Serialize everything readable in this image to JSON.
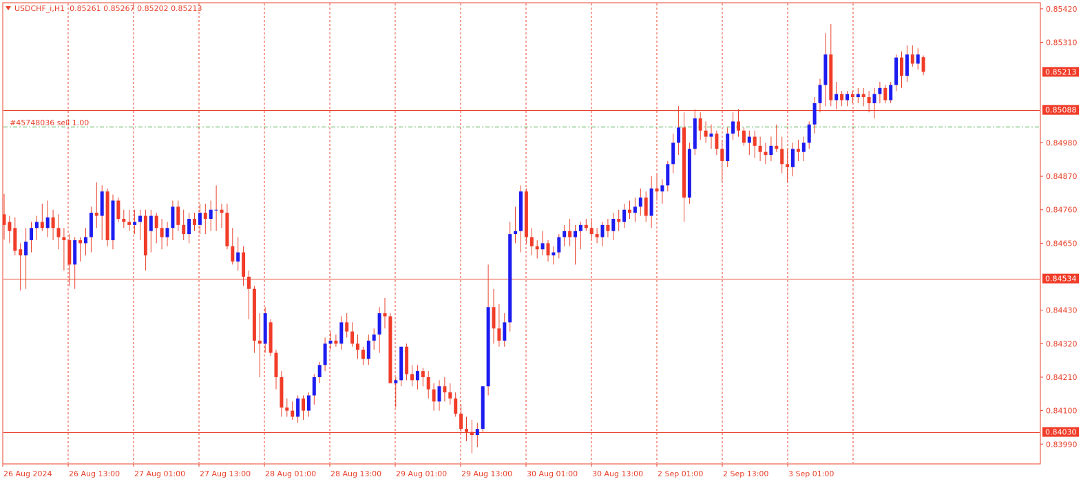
{
  "header": {
    "symbol": "USDCHF_i,H1",
    "ohlc": "0.85261 0.85267 0.85202 0.85213"
  },
  "order_line": {
    "label": "#45748036 sell 1.00",
    "price": 0.85032,
    "color": "#2ca02c"
  },
  "colors": {
    "bull": "#1c1cf0",
    "bear": "#f03c28",
    "wick": "#e8412b",
    "axis": "#e8412b",
    "grid": "#e8412b",
    "background": "#ffffff"
  },
  "chart_data": {
    "type": "candlestick",
    "ylim": [
      0.83925,
      0.8544
    ],
    "y_ticks": [
      0.8542,
      0.8531,
      0.8498,
      0.8487,
      0.8476,
      0.8465,
      0.8443,
      0.8432,
      0.8421,
      0.841,
      0.8399
    ],
    "y_tick_labels": [
      "0.85420",
      "0.85310",
      "0.84980",
      "0.84870",
      "0.84760",
      "0.84650",
      "0.84430",
      "0.84320",
      "0.84210",
      "0.84100",
      "0.83990"
    ],
    "x_tick_labels": [
      "26 Aug 2024",
      "26 Aug 13:00",
      "27 Aug 01:00",
      "27 Aug 13:00",
      "28 Aug 01:00",
      "28 Aug 13:00",
      "29 Aug 01:00",
      "29 Aug 13:00",
      "30 Aug 01:00",
      "30 Aug 13:00",
      "2 Sep 01:00",
      "2 Sep 13:00",
      "3 Sep 01:00"
    ],
    "horizontal_levels": [
      {
        "price": 0.85088,
        "label": "0.85088"
      },
      {
        "price": 0.84534,
        "label": "0.84534"
      },
      {
        "price": 0.8403,
        "label": "0.84030"
      }
    ],
    "current_price": {
      "price": 0.85213,
      "label": "0.85213"
    },
    "candles": [
      [
        0.84745,
        0.84812,
        0.84662,
        0.8471
      ],
      [
        0.8472,
        0.8474,
        0.8465,
        0.8469
      ],
      [
        0.847,
        0.84735,
        0.8461,
        0.84625
      ],
      [
        0.8463,
        0.8465,
        0.84495,
        0.8461
      ],
      [
        0.8461,
        0.847,
        0.845,
        0.84655
      ],
      [
        0.8466,
        0.8472,
        0.8462,
        0.847
      ],
      [
        0.847,
        0.8474,
        0.8466,
        0.8472
      ],
      [
        0.8472,
        0.8478,
        0.8469,
        0.847
      ],
      [
        0.847,
        0.8479,
        0.8467,
        0.84735
      ],
      [
        0.84735,
        0.8476,
        0.8466,
        0.847
      ],
      [
        0.847,
        0.84745,
        0.8463,
        0.8467
      ],
      [
        0.8467,
        0.847,
        0.8456,
        0.8466
      ],
      [
        0.8466,
        0.8468,
        0.8451,
        0.8458
      ],
      [
        0.8458,
        0.8467,
        0.845,
        0.8466
      ],
      [
        0.8466,
        0.8467,
        0.8459,
        0.8465
      ],
      [
        0.8465,
        0.847,
        0.8461,
        0.8467
      ],
      [
        0.8467,
        0.8477,
        0.8462,
        0.8475
      ],
      [
        0.8475,
        0.8485,
        0.847,
        0.8474
      ],
      [
        0.8474,
        0.8484,
        0.8466,
        0.8482
      ],
      [
        0.8482,
        0.8483,
        0.8464,
        0.8466
      ],
      [
        0.8466,
        0.8481,
        0.8463,
        0.8479
      ],
      [
        0.8479,
        0.848,
        0.8472,
        0.8473
      ],
      [
        0.8473,
        0.8476,
        0.847,
        0.8472
      ],
      [
        0.8472,
        0.8476,
        0.8469,
        0.8471
      ],
      [
        0.8471,
        0.8476,
        0.8468,
        0.8472
      ],
      [
        0.8472,
        0.8476,
        0.8466,
        0.8474
      ],
      [
        0.8474,
        0.8476,
        0.8456,
        0.8461
      ],
      [
        0.8469,
        0.8476,
        0.8462,
        0.8474
      ],
      [
        0.8474,
        0.8475,
        0.8465,
        0.847
      ],
      [
        0.847,
        0.8473,
        0.8463,
        0.8467
      ],
      [
        0.8467,
        0.8472,
        0.8464,
        0.847
      ],
      [
        0.847,
        0.8479,
        0.8466,
        0.8477
      ],
      [
        0.8477,
        0.8479,
        0.8469,
        0.8471
      ],
      [
        0.8471,
        0.8476,
        0.8466,
        0.8468
      ],
      [
        0.8468,
        0.8475,
        0.8465,
        0.8473
      ],
      [
        0.8473,
        0.8475,
        0.8469,
        0.8471
      ],
      [
        0.8471,
        0.8478,
        0.8468,
        0.8475
      ],
      [
        0.8475,
        0.8478,
        0.8468,
        0.8473
      ],
      [
        0.8473,
        0.8479,
        0.8469,
        0.8476
      ],
      [
        0.8476,
        0.8484,
        0.8469,
        0.8476
      ],
      [
        0.8476,
        0.8478,
        0.847,
        0.8475
      ],
      [
        0.8475,
        0.8478,
        0.8463,
        0.8464
      ],
      [
        0.8464,
        0.847,
        0.8458,
        0.8459
      ],
      [
        0.8459,
        0.8467,
        0.8456,
        0.8462
      ],
      [
        0.8462,
        0.8464,
        0.8451,
        0.8454
      ],
      [
        0.8454,
        0.8456,
        0.844,
        0.845
      ],
      [
        0.845,
        0.8451,
        0.8429,
        0.8433
      ],
      [
        0.8433,
        0.8442,
        0.8421,
        0.8432
      ],
      [
        0.8432,
        0.8444,
        0.8429,
        0.8442
      ],
      [
        0.8439,
        0.844,
        0.8428,
        0.8429
      ],
      [
        0.8429,
        0.843,
        0.8417,
        0.8421
      ],
      [
        0.8421,
        0.8423,
        0.8408,
        0.8411
      ],
      [
        0.8411,
        0.8414,
        0.8408,
        0.841
      ],
      [
        0.841,
        0.8413,
        0.8407,
        0.8408
      ],
      [
        0.8408,
        0.8415,
        0.8406,
        0.8414
      ],
      [
        0.8414,
        0.8415,
        0.8407,
        0.841
      ],
      [
        0.841,
        0.8416,
        0.8408,
        0.8415
      ],
      [
        0.8415,
        0.8422,
        0.8412,
        0.8421
      ],
      [
        0.8421,
        0.8426,
        0.8419,
        0.8425
      ],
      [
        0.8425,
        0.8434,
        0.8423,
        0.8432
      ],
      [
        0.8432,
        0.8436,
        0.843,
        0.8433
      ],
      [
        0.8433,
        0.8435,
        0.8431,
        0.8432
      ],
      [
        0.8432,
        0.8441,
        0.843,
        0.8439
      ],
      [
        0.8439,
        0.8442,
        0.8434,
        0.8436
      ],
      [
        0.8436,
        0.8439,
        0.8431,
        0.8432
      ],
      [
        0.8432,
        0.8435,
        0.8427,
        0.843
      ],
      [
        0.843,
        0.8431,
        0.8425,
        0.8427
      ],
      [
        0.8427,
        0.8435,
        0.8425,
        0.8433
      ],
      [
        0.8433,
        0.8437,
        0.843,
        0.8435
      ],
      [
        0.8435,
        0.8444,
        0.8429,
        0.8442
      ],
      [
        0.8442,
        0.8447,
        0.8437,
        0.8441
      ],
      [
        0.8441,
        0.8442,
        0.8422,
        0.8419
      ],
      [
        0.8419,
        0.8421,
        0.8411,
        0.842
      ],
      [
        0.842,
        0.843,
        0.8418,
        0.8431
      ],
      [
        0.8431,
        0.8432,
        0.842,
        0.8422
      ],
      [
        0.8422,
        0.8425,
        0.8418,
        0.842
      ],
      [
        0.842,
        0.8425,
        0.8417,
        0.8423
      ],
      [
        0.8423,
        0.8424,
        0.8418,
        0.8421
      ],
      [
        0.8421,
        0.8423,
        0.8414,
        0.8417
      ],
      [
        0.8417,
        0.8419,
        0.841,
        0.8413
      ],
      [
        0.8413,
        0.842,
        0.841,
        0.8418
      ],
      [
        0.8418,
        0.8421,
        0.8413,
        0.8416
      ],
      [
        0.8416,
        0.8419,
        0.8412,
        0.8414
      ],
      [
        0.8414,
        0.8416,
        0.8408,
        0.8409
      ],
      [
        0.8409,
        0.8412,
        0.8403,
        0.8404
      ],
      [
        0.8404,
        0.8408,
        0.84,
        0.8403
      ],
      [
        0.8403,
        0.8407,
        0.8396,
        0.8402
      ],
      [
        0.8402,
        0.8406,
        0.8398,
        0.8404
      ],
      [
        0.8404,
        0.8418,
        0.8403,
        0.8418
      ],
      [
        0.8418,
        0.8458,
        0.8415,
        0.8444
      ],
      [
        0.8444,
        0.845,
        0.8432,
        0.8437
      ],
      [
        0.8437,
        0.8445,
        0.8431,
        0.8433
      ],
      [
        0.8433,
        0.8442,
        0.8431,
        0.8439
      ],
      [
        0.8439,
        0.8472,
        0.8436,
        0.8468
      ],
      [
        0.8468,
        0.8477,
        0.8465,
        0.8469
      ],
      [
        0.8469,
        0.8484,
        0.8462,
        0.8482
      ],
      [
        0.8482,
        0.8483,
        0.8465,
        0.8467
      ],
      [
        0.8467,
        0.847,
        0.8461,
        0.8464
      ],
      [
        0.8464,
        0.8466,
        0.846,
        0.8463
      ],
      [
        0.8463,
        0.8469,
        0.8461,
        0.8465
      ],
      [
        0.8465,
        0.8466,
        0.8459,
        0.8461
      ],
      [
        0.8461,
        0.8464,
        0.8458,
        0.8462
      ],
      [
        0.8462,
        0.8468,
        0.846,
        0.8467
      ],
      [
        0.8467,
        0.8471,
        0.8464,
        0.8469
      ],
      [
        0.8469,
        0.8473,
        0.8464,
        0.8467
      ],
      [
        0.8467,
        0.8471,
        0.8458,
        0.8469
      ],
      [
        0.8469,
        0.8472,
        0.8463,
        0.8471
      ],
      [
        0.8471,
        0.8473,
        0.8469,
        0.847
      ],
      [
        0.847,
        0.8473,
        0.8466,
        0.8468
      ],
      [
        0.8468,
        0.847,
        0.8465,
        0.8467
      ],
      [
        0.8467,
        0.8472,
        0.8464,
        0.8471
      ],
      [
        0.8471,
        0.8473,
        0.8467,
        0.8469
      ],
      [
        0.8469,
        0.8475,
        0.8466,
        0.8473
      ],
      [
        0.8473,
        0.8476,
        0.8469,
        0.8472
      ],
      [
        0.8472,
        0.8478,
        0.847,
        0.8476
      ],
      [
        0.8476,
        0.8479,
        0.8473,
        0.8475
      ],
      [
        0.8475,
        0.848,
        0.8472,
        0.8477
      ],
      [
        0.8477,
        0.8483,
        0.8474,
        0.848
      ],
      [
        0.848,
        0.8482,
        0.8472,
        0.8474
      ],
      [
        0.8474,
        0.8487,
        0.847,
        0.8483
      ],
      [
        0.8483,
        0.8488,
        0.8479,
        0.8482
      ],
      [
        0.8482,
        0.8486,
        0.8478,
        0.8484
      ],
      [
        0.8484,
        0.8492,
        0.8482,
        0.8491
      ],
      [
        0.8491,
        0.8501,
        0.8488,
        0.8498
      ],
      [
        0.8498,
        0.851,
        0.8494,
        0.8503
      ],
      [
        0.8503,
        0.8508,
        0.8472,
        0.848
      ],
      [
        0.848,
        0.8498,
        0.8478,
        0.8496
      ],
      [
        0.8496,
        0.8509,
        0.8494,
        0.8506
      ],
      [
        0.8506,
        0.8508,
        0.8499,
        0.8502
      ],
      [
        0.8502,
        0.8505,
        0.8498,
        0.85
      ],
      [
        0.85,
        0.8504,
        0.8496,
        0.8501
      ],
      [
        0.8501,
        0.8502,
        0.8494,
        0.8496
      ],
      [
        0.8496,
        0.8499,
        0.8485,
        0.8492
      ],
      [
        0.8492,
        0.8503,
        0.849,
        0.8501
      ],
      [
        0.8501,
        0.8508,
        0.8499,
        0.8505
      ],
      [
        0.8505,
        0.8509,
        0.85,
        0.8502
      ],
      [
        0.8502,
        0.8503,
        0.8497,
        0.8498
      ],
      [
        0.8498,
        0.8502,
        0.8494,
        0.85
      ],
      [
        0.85,
        0.8502,
        0.8493,
        0.8497
      ],
      [
        0.8497,
        0.85,
        0.8492,
        0.8495
      ],
      [
        0.8495,
        0.8498,
        0.8491,
        0.8494
      ],
      [
        0.8494,
        0.85,
        0.8492,
        0.8497
      ],
      [
        0.8497,
        0.8504,
        0.8495,
        0.8496
      ],
      [
        0.8496,
        0.85,
        0.8488,
        0.8491
      ],
      [
        0.8491,
        0.8496,
        0.8485,
        0.849
      ],
      [
        0.849,
        0.8498,
        0.8487,
        0.8496
      ],
      [
        0.8496,
        0.8499,
        0.8492,
        0.8495
      ],
      [
        0.8495,
        0.85,
        0.8492,
        0.8498
      ],
      [
        0.8498,
        0.8505,
        0.8496,
        0.8504
      ],
      [
        0.8504,
        0.8513,
        0.8501,
        0.8511
      ],
      [
        0.8511,
        0.8519,
        0.8508,
        0.8517
      ],
      [
        0.8517,
        0.8534,
        0.851,
        0.8527
      ],
      [
        0.8527,
        0.8537,
        0.851,
        0.8512
      ],
      [
        0.8512,
        0.8518,
        0.8509,
        0.8514
      ],
      [
        0.8514,
        0.8515,
        0.851,
        0.8512
      ],
      [
        0.8512,
        0.8515,
        0.851,
        0.8514
      ],
      [
        0.8514,
        0.8515,
        0.8511,
        0.8513
      ],
      [
        0.8513,
        0.8516,
        0.8511,
        0.8514
      ],
      [
        0.8514,
        0.8516,
        0.851,
        0.8513
      ],
      [
        0.8513,
        0.8515,
        0.8508,
        0.8511
      ],
      [
        0.8511,
        0.8516,
        0.8506,
        0.8514
      ],
      [
        0.8514,
        0.8518,
        0.8511,
        0.8516
      ],
      [
        0.8516,
        0.8517,
        0.8511,
        0.8512
      ],
      [
        0.8512,
        0.8518,
        0.8511,
        0.8517
      ],
      [
        0.8517,
        0.8527,
        0.8515,
        0.8526
      ],
      [
        0.8526,
        0.8528,
        0.8516,
        0.852
      ],
      [
        0.852,
        0.853,
        0.8518,
        0.8527
      ],
      [
        0.8527,
        0.853,
        0.8523,
        0.8524
      ],
      [
        0.8524,
        0.8529,
        0.8522,
        0.8527
      ],
      [
        0.85261,
        0.85267,
        0.85202,
        0.85213
      ]
    ]
  }
}
